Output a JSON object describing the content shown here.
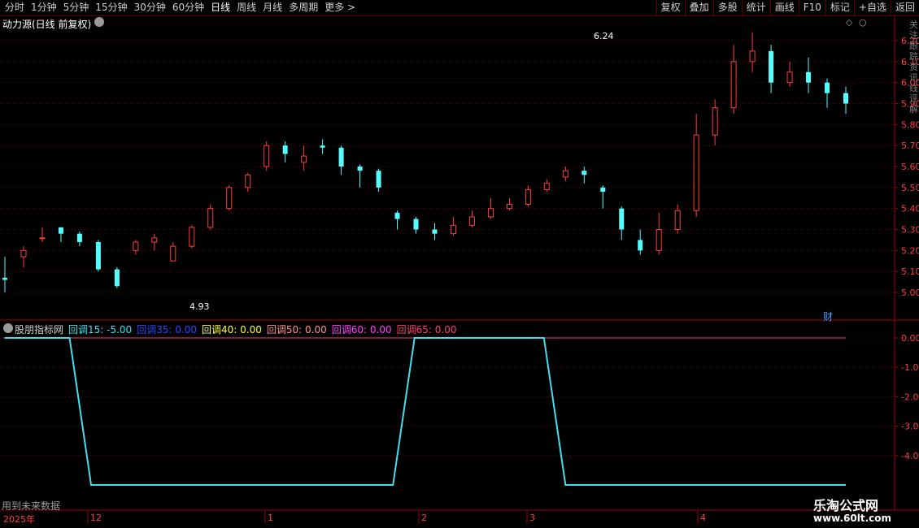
{
  "toolbar": {
    "periods": [
      "分时",
      "1分钟",
      "5分钟",
      "15分钟",
      "30分钟",
      "60分钟",
      "日线",
      "周线",
      "月线",
      "多周期",
      "更多 >"
    ],
    "active_period": "日线",
    "tools": [
      "复权",
      "叠加",
      "多股",
      "统计",
      "画线",
      "F10",
      "标记",
      "+自选",
      "返回"
    ]
  },
  "main_panel": {
    "title": "动力源(日线 前复权)",
    "price_axis": [
      "6.20",
      "6.10",
      "6.00",
      "5.90",
      "5.80",
      "5.70",
      "5.60",
      "5.50",
      "5.40",
      "5.30",
      "5.20",
      "5.10",
      "5.00"
    ],
    "high_label": "6.24",
    "low_label": "4.93",
    "fin_marker": "财",
    "side_text": "关注 跟踪 资讯 线 评 解"
  },
  "indicator_panel": {
    "name": "股朋指标网",
    "legend": [
      {
        "label": "回调15: -5.00",
        "color": "#40e0f0"
      },
      {
        "label": "回调35: 0.00",
        "color": "#3048ff"
      },
      {
        "label": "回调40: 0.00",
        "color": "#ffff40"
      },
      {
        "label": "回调50: 0.00",
        "color": "#ff9090"
      },
      {
        "label": "回调60: 0.00",
        "color": "#ff40ff"
      },
      {
        "label": "回调65: 0.00",
        "color": "#ff4070"
      }
    ],
    "axis": [
      "0.00",
      "-1.00",
      "-2.00",
      "-3.00",
      "-4.00"
    ]
  },
  "footer": {
    "future_note": "用到未来数据",
    "year": "2025年",
    "months": [
      "12",
      "1",
      "2",
      "3",
      "4"
    ]
  },
  "watermark": {
    "title": "乐淘公式网",
    "url": "www.60lt.com"
  },
  "colors": {
    "up": "#ff3c3c",
    "down": "#54ffff",
    "grid": "#7a0000",
    "axis_text": "#ff3c3c"
  },
  "chart_data": [
    {
      "type": "candlestick",
      "title": "动力源(日线 前复权)",
      "ylim": [
        4.9,
        6.3
      ],
      "candles": [
        [
          5.07,
          5.06,
          5.17,
          5.0
        ],
        [
          5.17,
          5.2,
          5.22,
          5.12
        ],
        [
          5.26,
          5.26,
          5.31,
          5.24
        ],
        [
          5.31,
          5.28,
          5.31,
          5.24
        ],
        [
          5.28,
          5.24,
          5.29,
          5.22
        ],
        [
          5.24,
          5.11,
          5.25,
          5.1
        ],
        [
          5.11,
          5.03,
          5.12,
          5.02
        ],
        [
          5.2,
          5.24,
          5.25,
          5.18
        ],
        [
          5.24,
          5.26,
          5.28,
          5.2
        ],
        [
          5.15,
          5.22,
          5.24,
          5.15
        ],
        [
          5.22,
          5.31,
          5.32,
          5.21
        ],
        [
          5.31,
          5.4,
          5.42,
          5.3
        ],
        [
          5.4,
          5.5,
          5.51,
          5.39
        ],
        [
          5.5,
          5.56,
          5.57,
          5.48
        ],
        [
          5.6,
          5.7,
          5.72,
          5.58
        ],
        [
          5.7,
          5.66,
          5.72,
          5.62
        ],
        [
          5.62,
          5.65,
          5.7,
          5.58
        ],
        [
          5.7,
          5.69,
          5.73,
          5.66
        ],
        [
          5.69,
          5.6,
          5.7,
          5.56
        ],
        [
          5.6,
          5.58,
          5.61,
          5.5
        ],
        [
          5.58,
          5.5,
          5.59,
          5.48
        ],
        [
          5.38,
          5.35,
          5.39,
          5.3
        ],
        [
          5.35,
          5.3,
          5.36,
          5.28
        ],
        [
          5.3,
          5.28,
          5.33,
          5.25
        ],
        [
          5.28,
          5.32,
          5.36,
          5.27
        ],
        [
          5.32,
          5.36,
          5.39,
          5.31
        ],
        [
          5.36,
          5.4,
          5.45,
          5.35
        ],
        [
          5.4,
          5.42,
          5.45,
          5.39
        ],
        [
          5.42,
          5.49,
          5.51,
          5.41
        ],
        [
          5.49,
          5.52,
          5.54,
          5.48
        ],
        [
          5.55,
          5.58,
          5.6,
          5.53
        ],
        [
          5.58,
          5.56,
          5.6,
          5.52
        ],
        [
          5.5,
          5.48,
          5.51,
          5.4
        ],
        [
          5.4,
          5.3,
          5.41,
          5.25
        ],
        [
          5.25,
          5.2,
          5.3,
          5.18
        ],
        [
          5.2,
          5.3,
          5.38,
          5.18
        ],
        [
          5.3,
          5.39,
          5.42,
          5.28
        ],
        [
          5.39,
          5.75,
          5.85,
          5.36
        ],
        [
          5.75,
          5.88,
          5.92,
          5.7
        ],
        [
          5.88,
          6.1,
          6.18,
          5.85
        ],
        [
          6.1,
          6.15,
          6.24,
          6.05
        ],
        [
          6.15,
          6.0,
          6.18,
          5.95
        ],
        [
          6.0,
          6.05,
          6.1,
          5.98
        ],
        [
          6.05,
          6.0,
          6.12,
          5.95
        ],
        [
          6.0,
          5.95,
          6.02,
          5.88
        ],
        [
          5.95,
          5.9,
          5.98,
          5.85
        ]
      ]
    },
    {
      "type": "line",
      "series": [
        {
          "name": "回调15",
          "values": [
            0,
            0,
            0,
            0,
            -5,
            -5,
            -5,
            -5,
            -5,
            -5,
            -5,
            -5,
            -5,
            -5,
            -5,
            -5,
            -5,
            -5,
            -5,
            0,
            0,
            0,
            0,
            0,
            0,
            0,
            -5,
            -5,
            -5,
            -5,
            -5,
            -5,
            -5,
            -5,
            -5,
            -5,
            -5,
            -5,
            -5,
            -5
          ]
        }
      ],
      "ylim": [
        -5,
        0
      ]
    }
  ]
}
